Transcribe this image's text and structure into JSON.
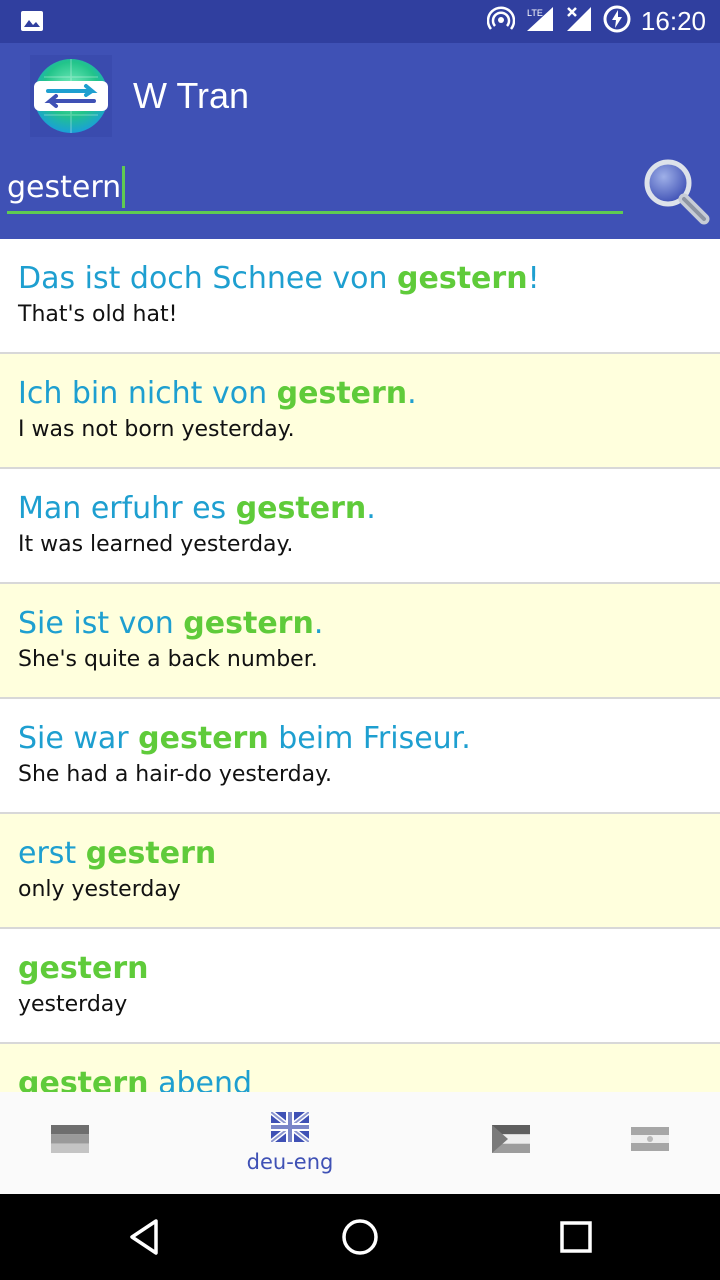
{
  "status_bar": {
    "time": "16:20",
    "network": "LTE",
    "icons": [
      "image-icon",
      "hotspot-icon",
      "signal-lte-icon",
      "signal-x-icon",
      "battery-charging-icon"
    ]
  },
  "app_bar": {
    "title": "W Tran",
    "logo_icon": "translate-globe-icon"
  },
  "search": {
    "value": "gestern",
    "button_icon": "search-icon"
  },
  "results": [
    {
      "de": [
        {
          "t": "Das ist doch Schnee von "
        },
        {
          "t": "gestern",
          "hl": true
        },
        {
          "t": "!"
        }
      ],
      "en": "That's old hat!"
    },
    {
      "de": [
        {
          "t": "Ich bin nicht von "
        },
        {
          "t": "gestern",
          "hl": true
        },
        {
          "t": "."
        }
      ],
      "en": "I was not born yesterday."
    },
    {
      "de": [
        {
          "t": "Man erfuhr es "
        },
        {
          "t": "gestern",
          "hl": true
        },
        {
          "t": "."
        }
      ],
      "en": "It was learned yesterday."
    },
    {
      "de": [
        {
          "t": "Sie ist von "
        },
        {
          "t": "gestern",
          "hl": true
        },
        {
          "t": "."
        }
      ],
      "en": "She's quite a back number."
    },
    {
      "de": [
        {
          "t": "Sie war "
        },
        {
          "t": "gestern",
          "hl": true
        },
        {
          "t": " beim Friseur."
        }
      ],
      "en": "She had a hair-do yesterday."
    },
    {
      "de": [
        {
          "t": "erst "
        },
        {
          "t": "gestern",
          "hl": true
        }
      ],
      "en": "only yesterday"
    },
    {
      "de": [
        {
          "t": "gestern",
          "hl": true
        }
      ],
      "en": "yesterday"
    },
    {
      "de": [
        {
          "t": "gestern",
          "hl": true
        },
        {
          "t": " abend"
        }
      ],
      "en": ""
    }
  ],
  "bottom_nav": {
    "items": [
      {
        "name": "flag-germany-icon",
        "label": ""
      },
      {
        "name": "flag-uk-icon",
        "label": "deu-eng",
        "active": true
      },
      {
        "name": "flag-palestine-icon",
        "label": ""
      },
      {
        "name": "flag-argentina-icon",
        "label": ""
      }
    ]
  },
  "colors": {
    "status_bar": "#303F9F",
    "app_bar": "#3F51B5",
    "german_text": "#1E9FD0",
    "highlight": "#5FCB3A",
    "odd_row": "#FFFFDD",
    "accent_line": "#5FCB52"
  }
}
